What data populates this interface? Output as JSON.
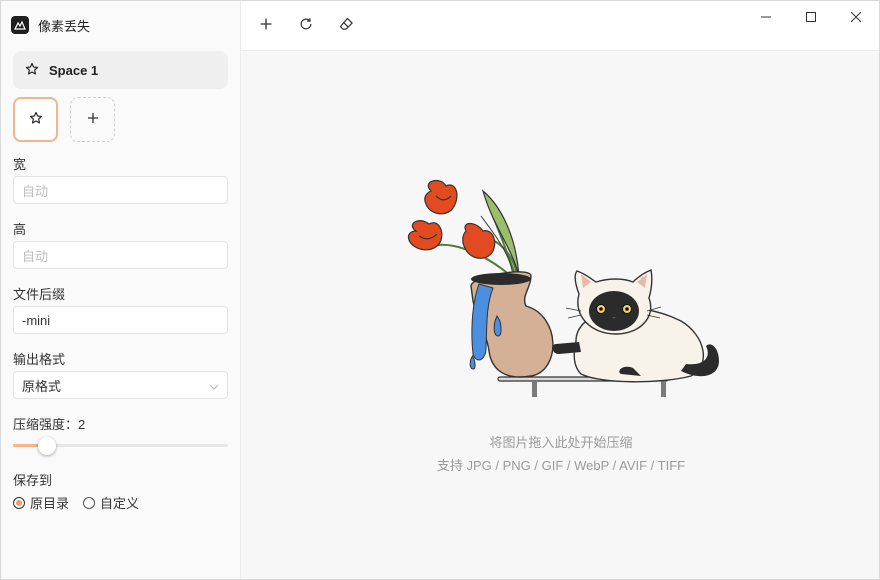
{
  "app": {
    "title": "像素丢失"
  },
  "sidebar": {
    "space": {
      "label": "Space 1"
    },
    "fields": {
      "width_label": "宽",
      "width_placeholder": "自动",
      "height_label": "高",
      "height_placeholder": "自动",
      "suffix_label": "文件后缀",
      "suffix_value": "-mini",
      "format_label": "输出格式",
      "format_value": "原格式",
      "compression_label": "压缩强度：2",
      "compression_value": 2,
      "compression_fraction": 0.16,
      "save_label": "保存到"
    },
    "save_options": [
      {
        "label": "原目录",
        "checked": true
      },
      {
        "label": "自定义",
        "checked": false
      }
    ]
  },
  "toolbar": {
    "icons": [
      "plus-icon",
      "refresh-icon",
      "eraser-icon"
    ],
    "window_icons": [
      "minimize-icon",
      "maximize-icon",
      "close-icon"
    ]
  },
  "main": {
    "drop_hint": "将图片拖入此处开始压缩",
    "formats_hint": "支持 JPG / PNG / GIF / WebP / AVIF / TIFF"
  },
  "colors": {
    "accent": "#f5b48a",
    "radio_fill": "#f39c62",
    "tulip": "#e24a1f",
    "vase": "#d4b196",
    "water": "#4a8fe0"
  }
}
